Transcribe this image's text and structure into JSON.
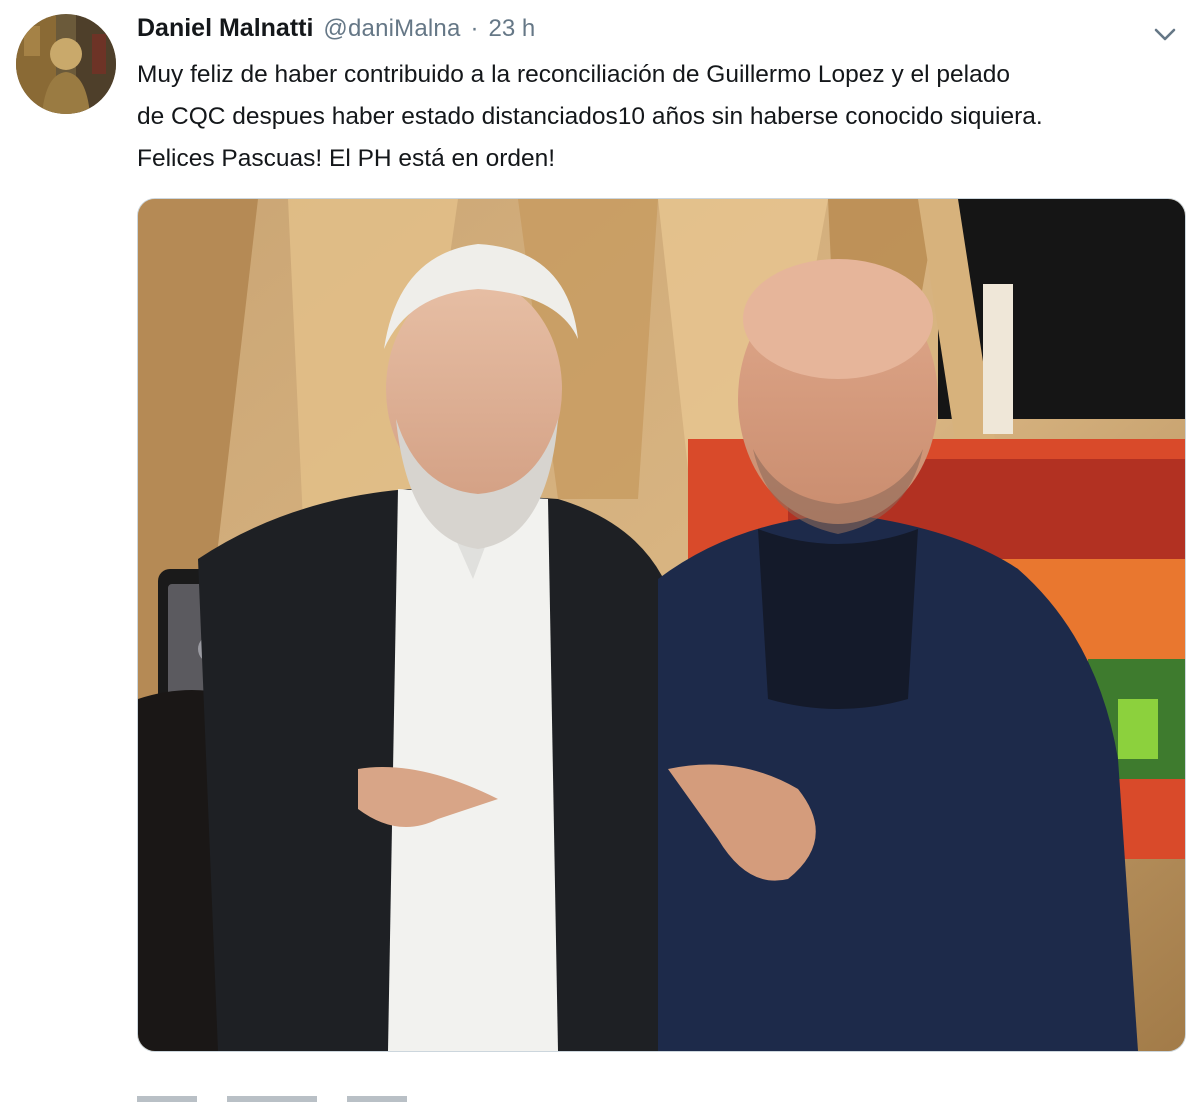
{
  "tweet": {
    "author_name": "Daniel Malnatti",
    "author_handle": "@daniMalna",
    "separator": "·",
    "timestamp": "23 h",
    "text_lines": [
      "Muy feliz de haber contribuido a la reconciliación de Guillermo Lopez y el pelado",
      "de CQC despues haber estado distanciados10 años sin haberse conocido siquiera.",
      "Felices Pascuas! El PH está en orden!"
    ]
  },
  "icons": {
    "menu": "chevron-down-icon",
    "avatar": "avatar-image"
  },
  "colors": {
    "text": "#14171a",
    "muted": "#657786",
    "border": "#ccd6dd"
  }
}
